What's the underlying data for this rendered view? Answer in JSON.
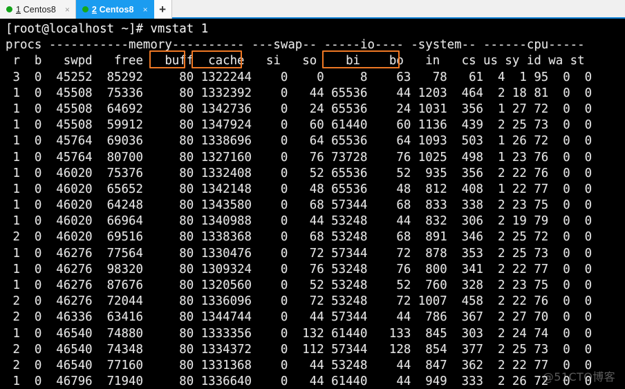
{
  "window": {
    "background": "#000000",
    "accent": "#1b9cf0",
    "highlight_color": "#ef7824",
    "text_color": "#e6e6e6"
  },
  "tabbar": {
    "tabs": [
      {
        "number": "1",
        "name": "Centos8",
        "label": "1 Centos8",
        "active": false,
        "dot_color": "#14a31a",
        "close_label": "×"
      },
      {
        "number": "2",
        "name": "Centos8",
        "label": "2 Centos8",
        "active": true,
        "dot_color": "#16a818",
        "close_label": "×"
      }
    ],
    "new_tab_label": "+"
  },
  "terminal": {
    "prompt_line": "[root@localhost ~]# vmstat 1",
    "group_header": "procs -----------memory---------- ---swap-- -----io---- -system-- ------cpu-----",
    "column_header": " r  b   swpd   free   buff  cache   si   so    bi    bo   in   cs us sy id wa st",
    "columns": [
      "r",
      "b",
      "swpd",
      "free",
      "buff",
      "cache",
      "si",
      "so",
      "bi",
      "bo",
      "in",
      "cs",
      "us",
      "sy",
      "id",
      "wa",
      "st"
    ],
    "group_labels": [
      "procs",
      "memory",
      "swap",
      "io",
      "system",
      "cpu"
    ],
    "highlights": [
      {
        "name": "buff",
        "label": "buff"
      },
      {
        "name": "cache",
        "label": "cache"
      },
      {
        "name": "bi-bo",
        "label": "bi  bo"
      }
    ],
    "rows": [
      " 3  0  45252  85292     80 1322244    0    0     8    63   78   61  4  1 95  0  0",
      " 1  0  45508  75336     80 1332392    0   44 65536    44 1203  464  2 18 81  0  0",
      " 1  0  45508  64692     80 1342736    0   24 65536    24 1031  356  1 27 72  0  0",
      " 1  0  45508  59912     80 1347924    0   60 61440    60 1136  439  2 25 73  0  0",
      " 1  0  45764  69036     80 1338696    0   64 65536    64 1093  503  1 26 72  0  0",
      " 1  0  45764  80700     80 1327160    0   76 73728    76 1025  498  1 23 76  0  0",
      " 1  0  46020  75376     80 1332408    0   52 65536    52  935  356  2 22 76  0  0",
      " 1  0  46020  65652     80 1342148    0   48 65536    48  812  408  1 22 77  0  0",
      " 1  0  46020  64248     80 1343580    0   68 57344    68  833  338  2 23 75  0  0",
      " 1  0  46020  66964     80 1340988    0   44 53248    44  832  306  2 19 79  0  0",
      " 2  0  46020  69516     80 1338368    0   68 53248    68  891  346  2 25 72  0  0",
      " 1  0  46276  77564     80 1330476    0   72 57344    72  878  353  2 25 73  0  0",
      " 1  0  46276  98320     80 1309324    0   76 53248    76  800  341  2 22 77  0  0",
      " 1  0  46276  87676     80 1320560    0   52 53248    52  760  328  2 23 75  0  0",
      " 2  0  46276  72044     80 1336096    0   72 53248    72 1007  458  2 22 76  0  0",
      " 2  0  46336  63416     80 1344744    0   44 57344    44  786  367  2 27 70  0  0",
      " 1  0  46540  74880     80 1333356    0  132 61440   133  845  303  2 24 74  0  0",
      " 2  0  46540  74348     80 1334372    0  112 57344   128  854  377  2 25 73  0  0",
      " 2  0  46540  77160     80 1331368    0   44 53248    44  847  362  2 22 77  0  0",
      " 1  0  46796  71940     80 1336640    0   44 61440    44  949  333  2 26 72  0  0"
    ]
  },
  "watermark": {
    "text": "@51CTO博客"
  }
}
